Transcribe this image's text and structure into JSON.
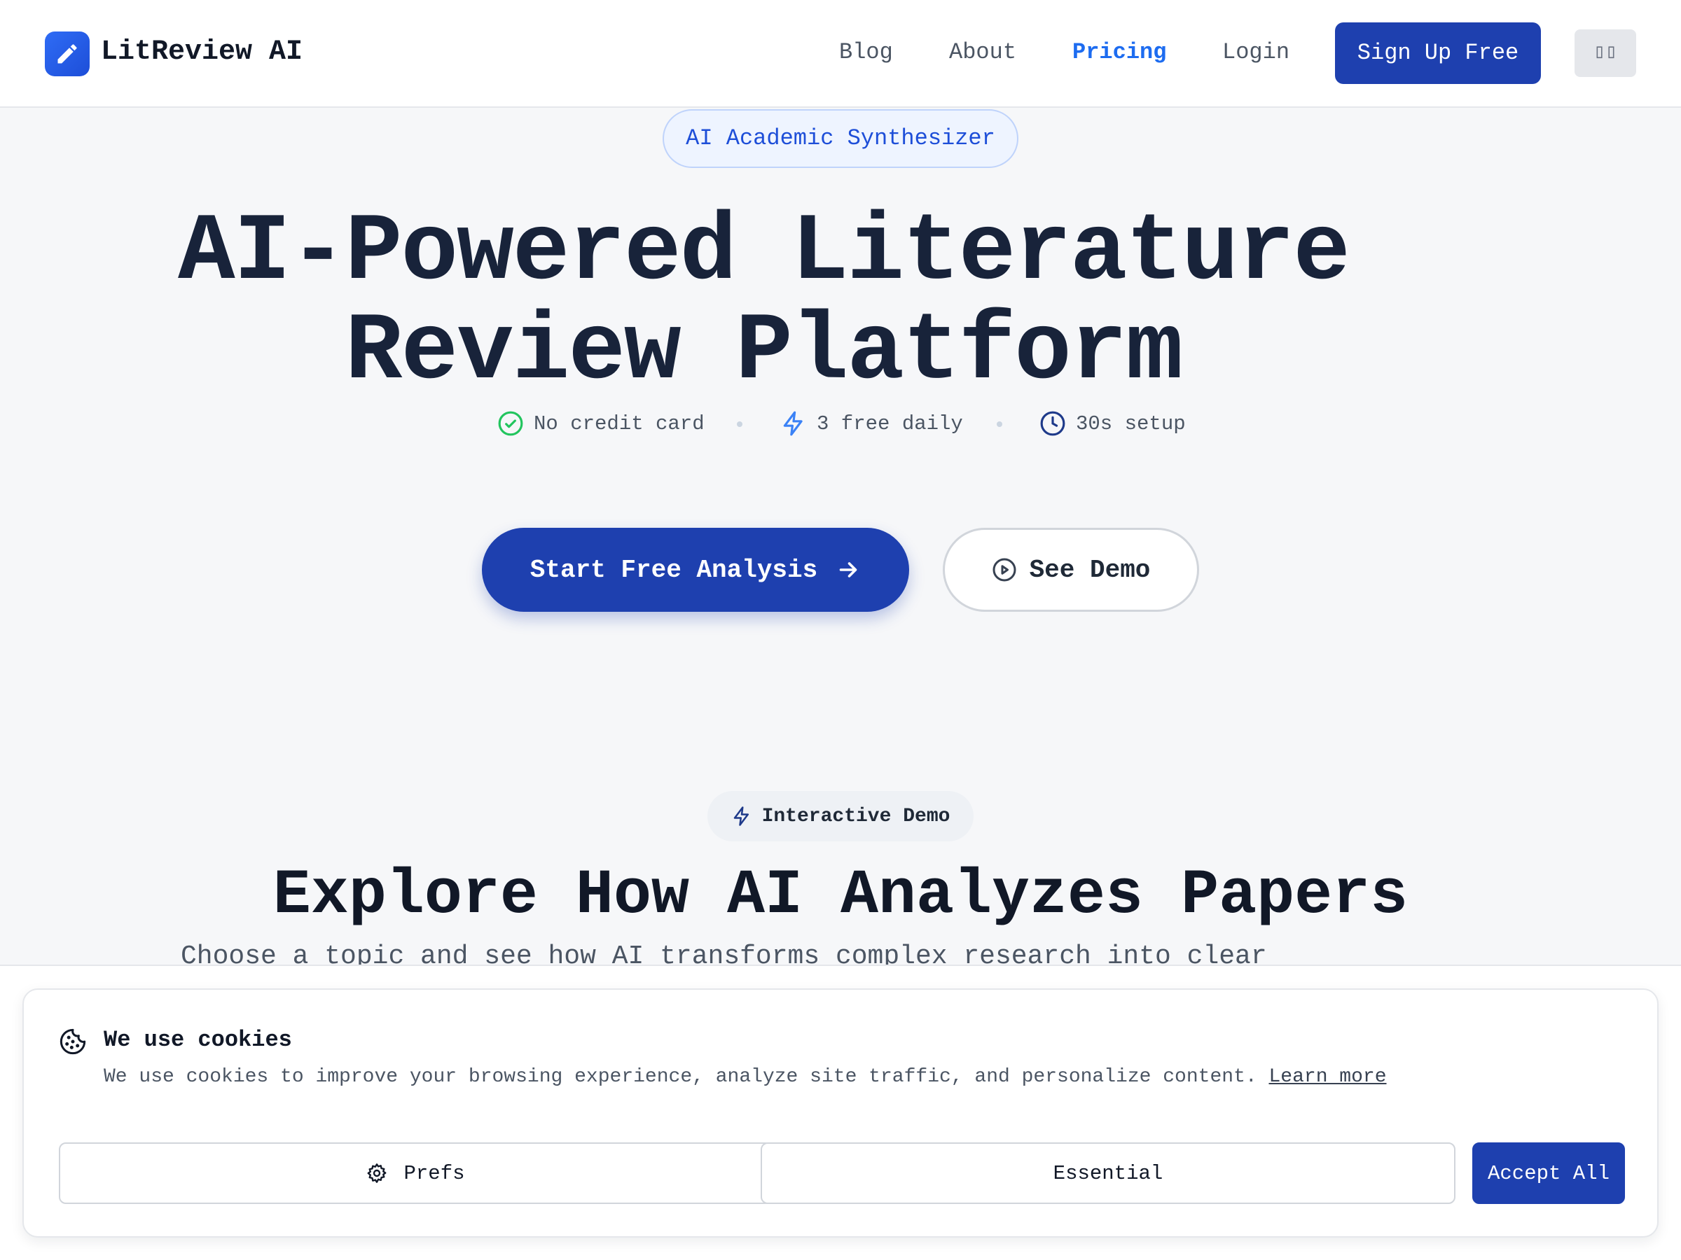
{
  "header": {
    "brand": "LitReview AI",
    "logo_icon": "pencil-icon",
    "nav": [
      {
        "label": "Blog",
        "active": false
      },
      {
        "label": "About",
        "active": false
      },
      {
        "label": "Pricing",
        "active": true
      },
      {
        "label": "Login",
        "active": false
      }
    ],
    "signup_label": "Sign Up Free",
    "theme_toggle_label": "▯▯"
  },
  "hero": {
    "badge": "AI Academic Synthesizer",
    "title_line1": "AI-Powered Literature",
    "title_line2": "Review Platform",
    "features": [
      {
        "icon": "check-circle-icon",
        "label": "No credit card",
        "color": "#22c55e"
      },
      {
        "icon": "lightning-icon",
        "label": "3 free daily",
        "color": "#3b82f6"
      },
      {
        "icon": "clock-icon",
        "label": "30s setup",
        "color": "#1e3a8a"
      }
    ],
    "cta_primary": "Start Free Analysis",
    "cta_secondary": "See Demo"
  },
  "demo": {
    "badge": "Interactive Demo",
    "title": "Explore How AI Analyzes Papers",
    "subtitle": "Choose a topic and see how AI transforms complex research into clear"
  },
  "cookie": {
    "title": "We use cookies",
    "text": "We use cookies to improve your browsing experience, analyze site traffic, and personalize content.",
    "learn_more": "Learn more",
    "prefs_label": "Prefs",
    "essential_label": "Essential",
    "accept_label": "Accept All"
  },
  "colors": {
    "primary": "#1e40af",
    "accent_link": "#1d6cf0",
    "background": "#f6f7f9"
  }
}
